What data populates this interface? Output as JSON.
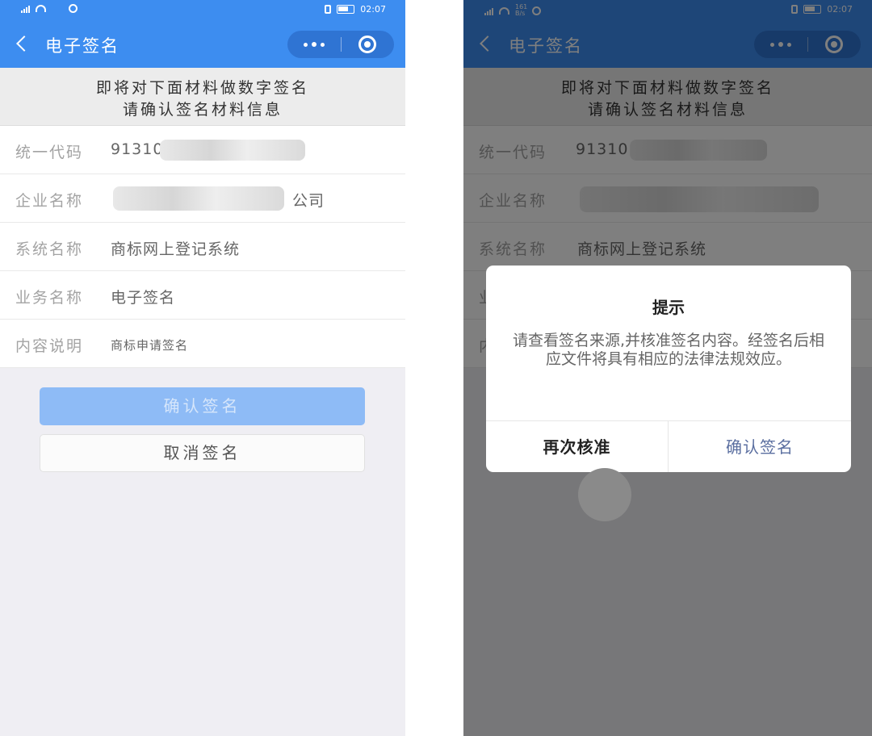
{
  "status": {
    "network_left": "161",
    "network_right": "B/s",
    "time": "02:07"
  },
  "nav": {
    "title": "电子签名"
  },
  "notice": {
    "line1": "即将对下面材料做数字签名",
    "line2": "请确认签名材料信息"
  },
  "rows": [
    {
      "label": "统一代码",
      "value": "91310"
    },
    {
      "label": "企业名称",
      "value": "公司"
    },
    {
      "label": "系统名称",
      "value": "商标网上登记系统"
    },
    {
      "label": "业务名称",
      "value": "电子签名"
    },
    {
      "label": "内容说明",
      "value": "商标申请签名"
    }
  ],
  "buttons": {
    "confirm": "确认签名",
    "cancel": "取消签名"
  },
  "dialog": {
    "title": "提示",
    "message": "请查看签名来源,并核准签名内容。经签名后相应文件将具有相应的法律法规效应。",
    "left_button": "再次核准",
    "right_button": "确认签名"
  },
  "colors": {
    "brand_blue": "#3d8df0",
    "confirm_disabled": "#8ebbf6",
    "dialog_confirm_text": "#5b6fa0"
  }
}
